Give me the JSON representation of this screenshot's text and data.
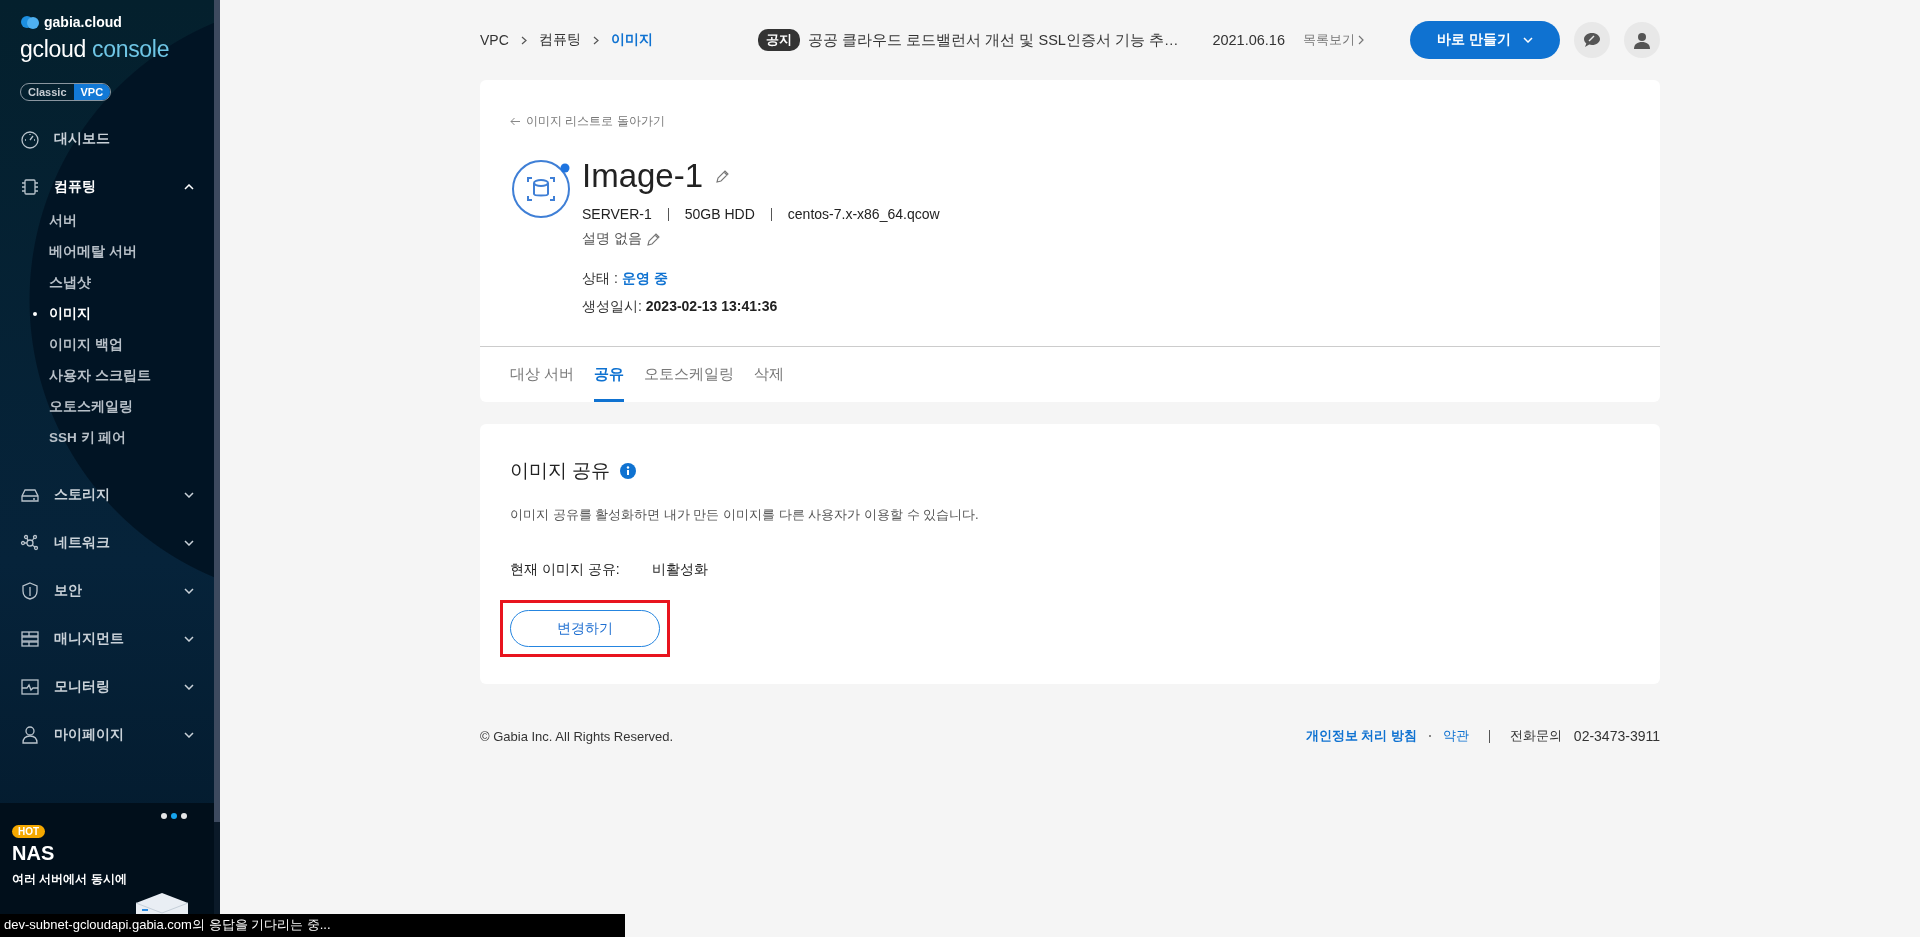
{
  "sidebar": {
    "brand": "gabia.cloud",
    "product": [
      "gcloud",
      "console"
    ],
    "mode_toggle": [
      {
        "label": "Classic",
        "selected": false
      },
      {
        "label": "VPC",
        "selected": true
      }
    ],
    "nav": [
      {
        "label": "대시보드"
      },
      {
        "label": "컴퓨팅",
        "expanded": true,
        "children": [
          {
            "label": "서버",
            "selected": false
          },
          {
            "label": "베어메탈 서버",
            "selected": false
          },
          {
            "label": "스냅샷",
            "selected": false
          },
          {
            "label": "이미지",
            "selected": true
          },
          {
            "label": "이미지 백업",
            "selected": false
          },
          {
            "label": "사용자 스크립트",
            "selected": false
          },
          {
            "label": "오토스케일링",
            "selected": false
          },
          {
            "label": "SSH 키 페어",
            "selected": false
          }
        ]
      },
      {
        "label": "스토리지",
        "expanded": false
      },
      {
        "label": "네트워크",
        "expanded": false
      },
      {
        "label": "보안",
        "expanded": false
      },
      {
        "label": "매니지먼트",
        "expanded": false
      },
      {
        "label": "모니터링",
        "expanded": false
      },
      {
        "label": "마이페이지",
        "expanded": false
      }
    ],
    "banner": {
      "dots": [
        {
          "selected": false
        },
        {
          "selected": true
        },
        {
          "selected": false
        }
      ],
      "badge": "HOT",
      "title": "NAS",
      "text": "여러 서버에서 동시에"
    }
  },
  "header": {
    "breadcrumb": [
      {
        "label": "VPC",
        "selected": false
      },
      {
        "label": "컴퓨팅",
        "selected": false
      },
      {
        "label": "이미지",
        "selected": true
      }
    ],
    "notice": {
      "badge": "공지",
      "text": "공공 클라우드 로드밸런서 개선 및 SSL인증서 기능 추…",
      "date": "2021.06.16",
      "more": "목록보기"
    },
    "create_button": "바로 만들기"
  },
  "detail": {
    "back_link": "이미지 리스트로 돌아가기",
    "name": "Image-1",
    "specs": [
      "SERVER-1",
      "50GB HDD",
      "centos-7.x-x86_64.qcow"
    ],
    "description": "설명 없음",
    "status_label": "상태 :",
    "status": "운영 중",
    "created_label": "생성일시:",
    "created": "2023-02-13 13:41:36",
    "tabs": [
      {
        "label": "대상 서버",
        "selected": false
      },
      {
        "label": "공유",
        "selected": true
      },
      {
        "label": "오토스케일링",
        "selected": false
      },
      {
        "label": "삭제",
        "selected": false
      }
    ]
  },
  "share": {
    "title": "이미지 공유",
    "description": "이미지 공유를 활성화하면 내가 만든 이미지를 다른 사용자가 이용할 수 있습니다.",
    "current_label": "현재 이미지 공유:",
    "current_value": "비활성화",
    "button": "변경하기",
    "highlighted": true
  },
  "footer": {
    "copyright": "© Gabia Inc. All Rights Reserved.",
    "links": [
      "개인정보 처리 방침",
      "약관"
    ],
    "phone_label": "전화문의",
    "phone": "02-3473-3911"
  },
  "status_bar": "dev-subnet-gcloudapi.gabia.com의 응답을 기다리는 중..."
}
